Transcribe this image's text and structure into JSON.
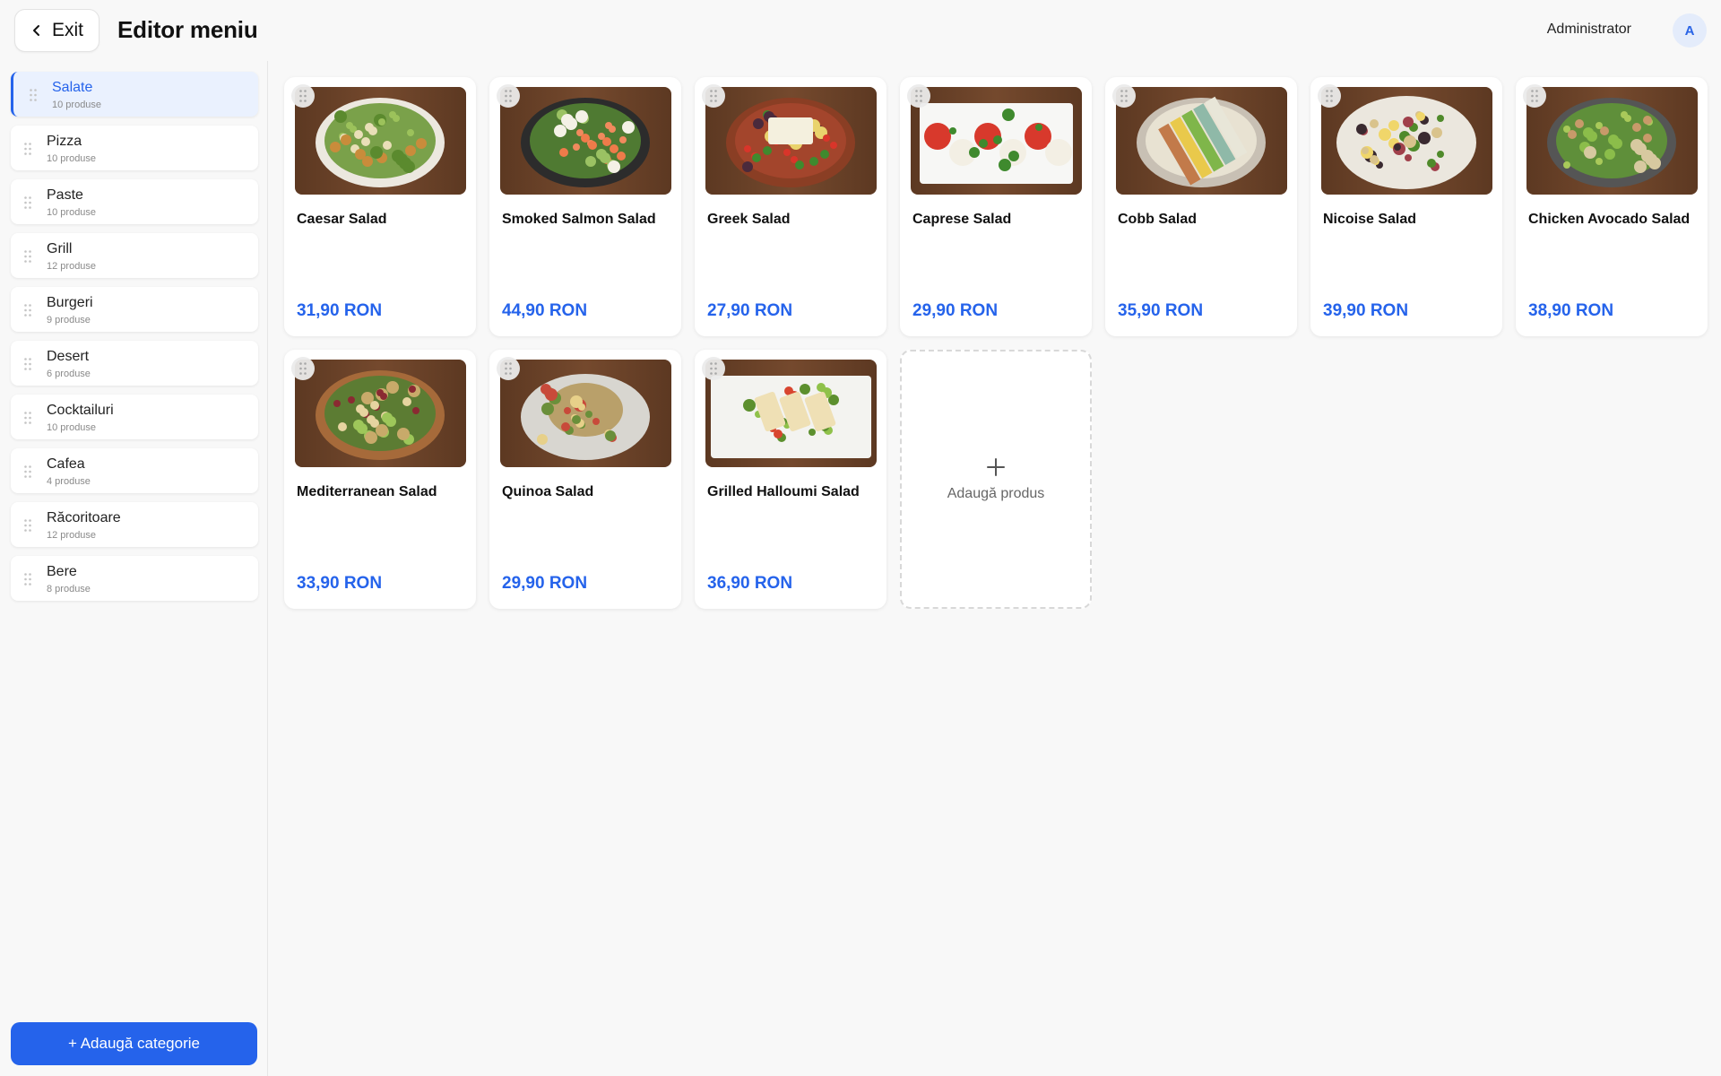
{
  "header": {
    "exit_label": "Exit",
    "title": "Editor meniu",
    "user": "Administrator",
    "avatar_initial": "A"
  },
  "sidebar": {
    "categories": [
      {
        "name": "Salate",
        "count": "10 produse",
        "active": true
      },
      {
        "name": "Pizza",
        "count": "10 produse"
      },
      {
        "name": "Paste",
        "count": "10 produse"
      },
      {
        "name": "Grill",
        "count": "12 produse"
      },
      {
        "name": "Burgeri",
        "count": "9 produse"
      },
      {
        "name": "Desert",
        "count": "6 produse"
      },
      {
        "name": "Cocktailuri",
        "count": "10 produse"
      },
      {
        "name": "Cafea",
        "count": "4 produse"
      },
      {
        "name": "Răcoritoare",
        "count": "12 produse"
      },
      {
        "name": "Bere",
        "count": "8 produse"
      }
    ],
    "add_category_label": "+ Adaugă categorie"
  },
  "products": [
    {
      "name": "Caesar Salad",
      "price": "31,90 RON",
      "image": "caesar-salad-photo"
    },
    {
      "name": "Smoked Salmon Salad",
      "price": "44,90 RON",
      "image": "smoked-salmon-salad-photo"
    },
    {
      "name": "Greek Salad",
      "price": "27,90 RON",
      "image": "greek-salad-photo"
    },
    {
      "name": "Caprese Salad",
      "price": "29,90 RON",
      "image": "caprese-salad-photo"
    },
    {
      "name": "Cobb Salad",
      "price": "35,90 RON",
      "image": "cobb-salad-photo"
    },
    {
      "name": "Nicoise Salad",
      "price": "39,90 RON",
      "image": "nicoise-salad-photo"
    },
    {
      "name": "Chicken Avocado Salad",
      "price": "38,90 RON",
      "image": "chicken-avocado-salad-photo"
    },
    {
      "name": "Mediterranean Salad",
      "price": "33,90 RON",
      "image": "mediterranean-salad-photo"
    },
    {
      "name": "Quinoa Salad",
      "price": "29,90 RON",
      "image": "quinoa-salad-photo"
    },
    {
      "name": "Grilled Halloumi Salad",
      "price": "36,90 RON",
      "image": "grilled-halloumi-salad-photo"
    }
  ],
  "add_product": {
    "icon": "plus-icon",
    "label": "Adaugă produs"
  },
  "colors": {
    "accent": "#2563eb",
    "active_bg": "#eaf1fe",
    "page_bg": "#f8f8f8"
  }
}
